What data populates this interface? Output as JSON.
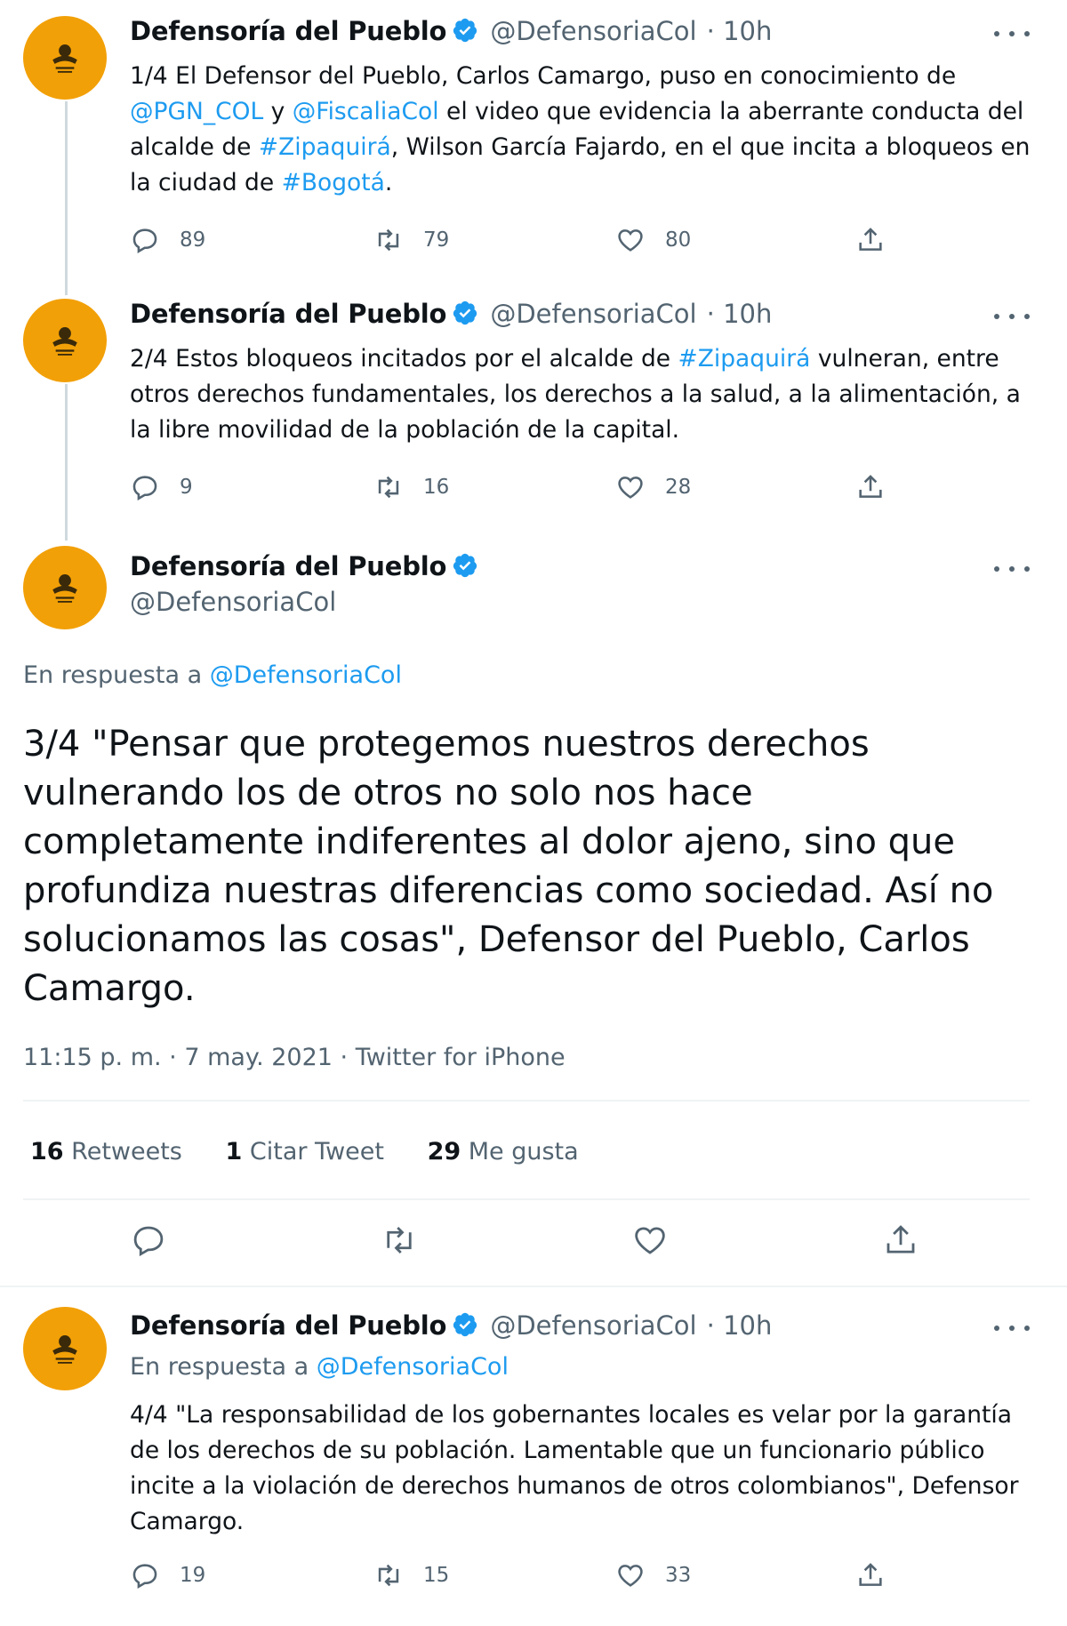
{
  "account": {
    "name": "Defensoría del Pueblo",
    "handle": "@DefensoriaCol",
    "avatar_color": "#f2a007",
    "verified_color": "#1d9bf0"
  },
  "tweet1": {
    "time": "· 10h",
    "text_parts": [
      {
        "t": "1/4 El Defensor del Pueblo, Carlos Camargo, puso en conocimiento de "
      },
      {
        "t": "@PGN_COL",
        "link": true
      },
      {
        "t": " y "
      },
      {
        "t": "@FiscaliaCol",
        "link": true
      },
      {
        "t": " el video que evidencia la aberrante conducta del alcalde de "
      },
      {
        "t": "#Zipaquirá",
        "link": true
      },
      {
        "t": ", Wilson García Fajardo, en el que incita a bloqueos en la ciudad de "
      },
      {
        "t": "#Bogotá",
        "link": true
      },
      {
        "t": "."
      }
    ],
    "replies": "89",
    "retweets": "79",
    "likes": "80"
  },
  "tweet2": {
    "time": "· 10h",
    "text_parts": [
      {
        "t": "2/4 Estos bloqueos incitados por el alcalde de "
      },
      {
        "t": "#Zipaquirá",
        "link": true
      },
      {
        "t": " vulneran, entre otros derechos fundamentales, los derechos a la salud, a la alimentación, a la libre movilidad de la población de la capital."
      }
    ],
    "replies": "9",
    "retweets": "16",
    "likes": "28"
  },
  "main": {
    "reply_prefix": "En respuesta a ",
    "reply_handle": "@DefensoriaCol",
    "text": "3/4 \"Pensar que protegemos nuestros derechos vulnerando los de otros no solo nos hace completamente indiferentes al dolor ajeno, sino que profundiza nuestras diferencias como sociedad. Así no solucionamos las cosas\", Defensor del Pueblo, Carlos Camargo.",
    "meta": "11:15 p. m. · 7 may. 2021 · Twitter for iPhone",
    "stats": {
      "retweets_count": "16",
      "retweets_label": "Retweets",
      "quotes_count": "1",
      "quotes_label": "Citar Tweet",
      "likes_count": "29",
      "likes_label": "Me gusta"
    }
  },
  "tweet4": {
    "time": "· 10h",
    "reply_prefix": "En respuesta a ",
    "reply_handle": "@DefensoriaCol",
    "text": "4/4 \"La responsabilidad de los gobernantes locales es velar por la garantía de los derechos de su población. Lamentable que un funcionario público incite a la violación de derechos humanos de otros colombianos\", Defensor Camargo.",
    "replies": "19",
    "retweets": "15",
    "likes": "33"
  }
}
